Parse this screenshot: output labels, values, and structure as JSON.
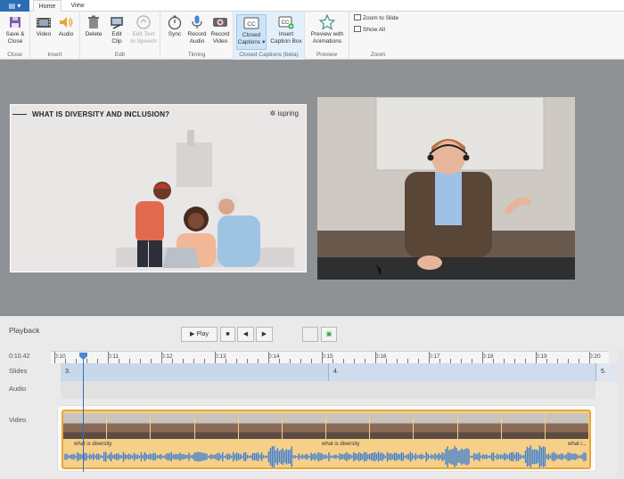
{
  "app": {
    "menu_label": "▤ ▾"
  },
  "tabs": [
    {
      "label": "Home",
      "active": true
    },
    {
      "label": "View",
      "active": false
    }
  ],
  "ribbon": {
    "groups": [
      {
        "label": "Close"
      },
      {
        "label": "Insert"
      },
      {
        "label": "Edit"
      },
      {
        "label": "Timing"
      },
      {
        "label": "Closed Captions (beta)"
      },
      {
        "label": "Preview"
      },
      {
        "label": "Zoom"
      }
    ],
    "buttons": {
      "save_close": "Save &\nClose",
      "video": "Video",
      "audio": "Audio",
      "delete": "Delete",
      "edit_clip": "Edit\nClip",
      "edit_text_to_speech": "Edit Text\nto Speech",
      "sync": "Sync",
      "record_audio": "Record\nAudio",
      "record_video": "Record\nVideo",
      "closed_captions": "Closed\nCaptions ▾",
      "insert_caption_box": "Insert\nCaption Box",
      "preview_with_animations": "Preview with\nAnimations",
      "zoom_to_slide": "Zoom to Slide",
      "show_all": "Show All"
    }
  },
  "slide": {
    "title": "WHAT IS DIVERSITY AND INCLUSION?",
    "logo": "✲ ispring"
  },
  "playback": {
    "label": "Playback",
    "play_label": "▶ Play",
    "stop_label": "■",
    "prev_label": "◀",
    "next_label": "▶",
    "timecode": "0:10.42",
    "ticks": [
      "0:10",
      "0:11",
      "0:12",
      "0:13",
      "0:14",
      "0:15",
      "0:16",
      "0:17",
      "0:18",
      "0:19",
      "0:20"
    ],
    "row_labels": {
      "slides": "Slides",
      "audio": "Audio",
      "video": "Video"
    },
    "slide_segments": [
      "3.",
      "4.",
      "5."
    ],
    "captions": [
      "what is diversity",
      "what is diversity",
      "what i..."
    ]
  },
  "colors": {
    "accent": "#2d6db5",
    "clip_fill": "#f6cf88",
    "clip_border": "#e8a636",
    "wave": "#3a7fd5"
  }
}
